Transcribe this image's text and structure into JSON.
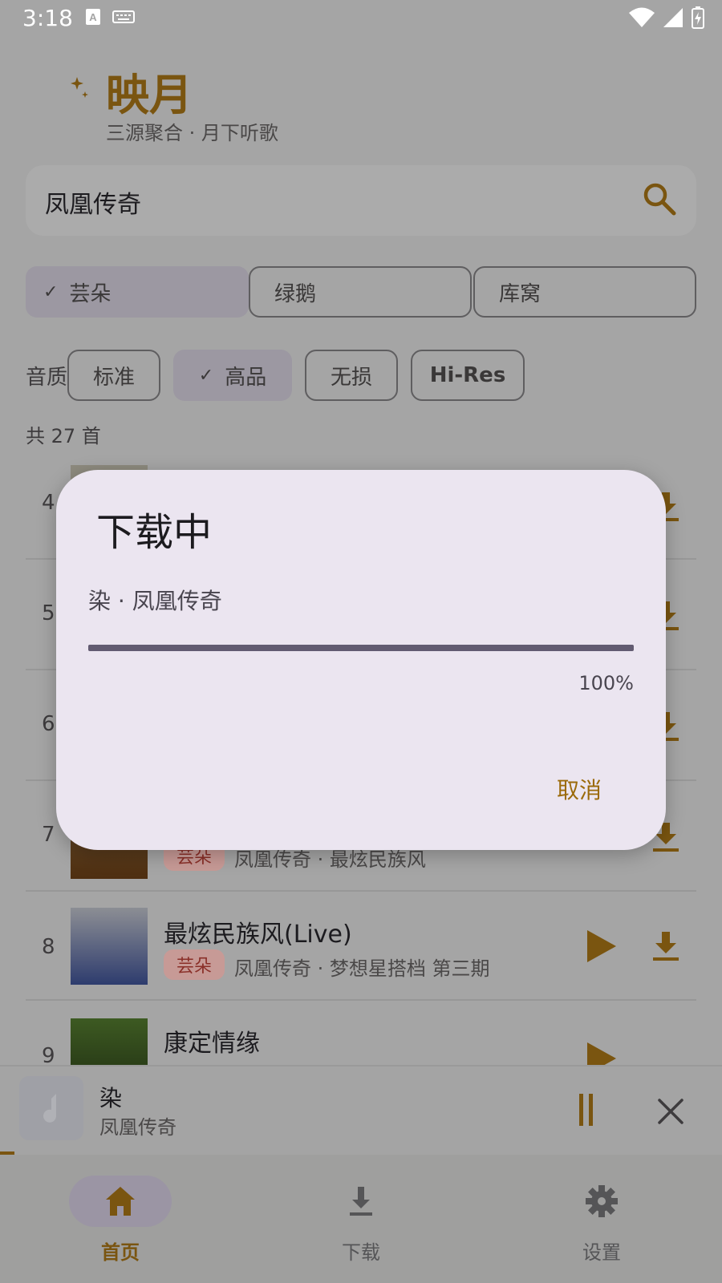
{
  "status": {
    "time": "3:18"
  },
  "header": {
    "title": "映月",
    "subtitle": "三源聚合 · 月下听歌"
  },
  "search": {
    "value": "凤凰传奇"
  },
  "sources": [
    {
      "label": "芸朵",
      "selected": true
    },
    {
      "label": "绿鹅",
      "selected": false
    },
    {
      "label": "库窝",
      "selected": false
    }
  ],
  "quality": {
    "label": "音质",
    "options": [
      {
        "label": "标准",
        "selected": false
      },
      {
        "label": "高品",
        "selected": true
      },
      {
        "label": "无损",
        "selected": false
      },
      {
        "label": "Hi-Res",
        "selected": false
      }
    ]
  },
  "results": {
    "count_text": "共 27 首",
    "rows": [
      {
        "num": "4",
        "title": "",
        "badge": "",
        "sub": ""
      },
      {
        "num": "5",
        "title": "",
        "badge": "",
        "sub": ""
      },
      {
        "num": "6",
        "title": "",
        "badge": "",
        "sub": ""
      },
      {
        "num": "7",
        "title": "",
        "badge": "芸朵",
        "sub": "凤凰传奇 · 最炫民族风"
      },
      {
        "num": "8",
        "title": "最炫民族风(Live)",
        "badge": "芸朵",
        "sub": "凤凰传奇 · 梦想星搭档 第三期"
      },
      {
        "num": "9",
        "title": "康定情缘",
        "badge": "",
        "sub": ""
      }
    ]
  },
  "player": {
    "title": "染",
    "artist": "凤凰传奇"
  },
  "nav": [
    {
      "label": "首页",
      "active": true
    },
    {
      "label": "下载",
      "active": false
    },
    {
      "label": "设置",
      "active": false
    }
  ],
  "dialog": {
    "title": "下载中",
    "subtitle": "染 · 凤凰传奇",
    "progress": 1.0,
    "percent_text": "100%",
    "cancel_label": "取消"
  },
  "colors": {
    "accent": "#7a5510",
    "badge_text": "#8a2f28",
    "progress": "#625b71",
    "dialog_bg": "#ebe5f0"
  }
}
